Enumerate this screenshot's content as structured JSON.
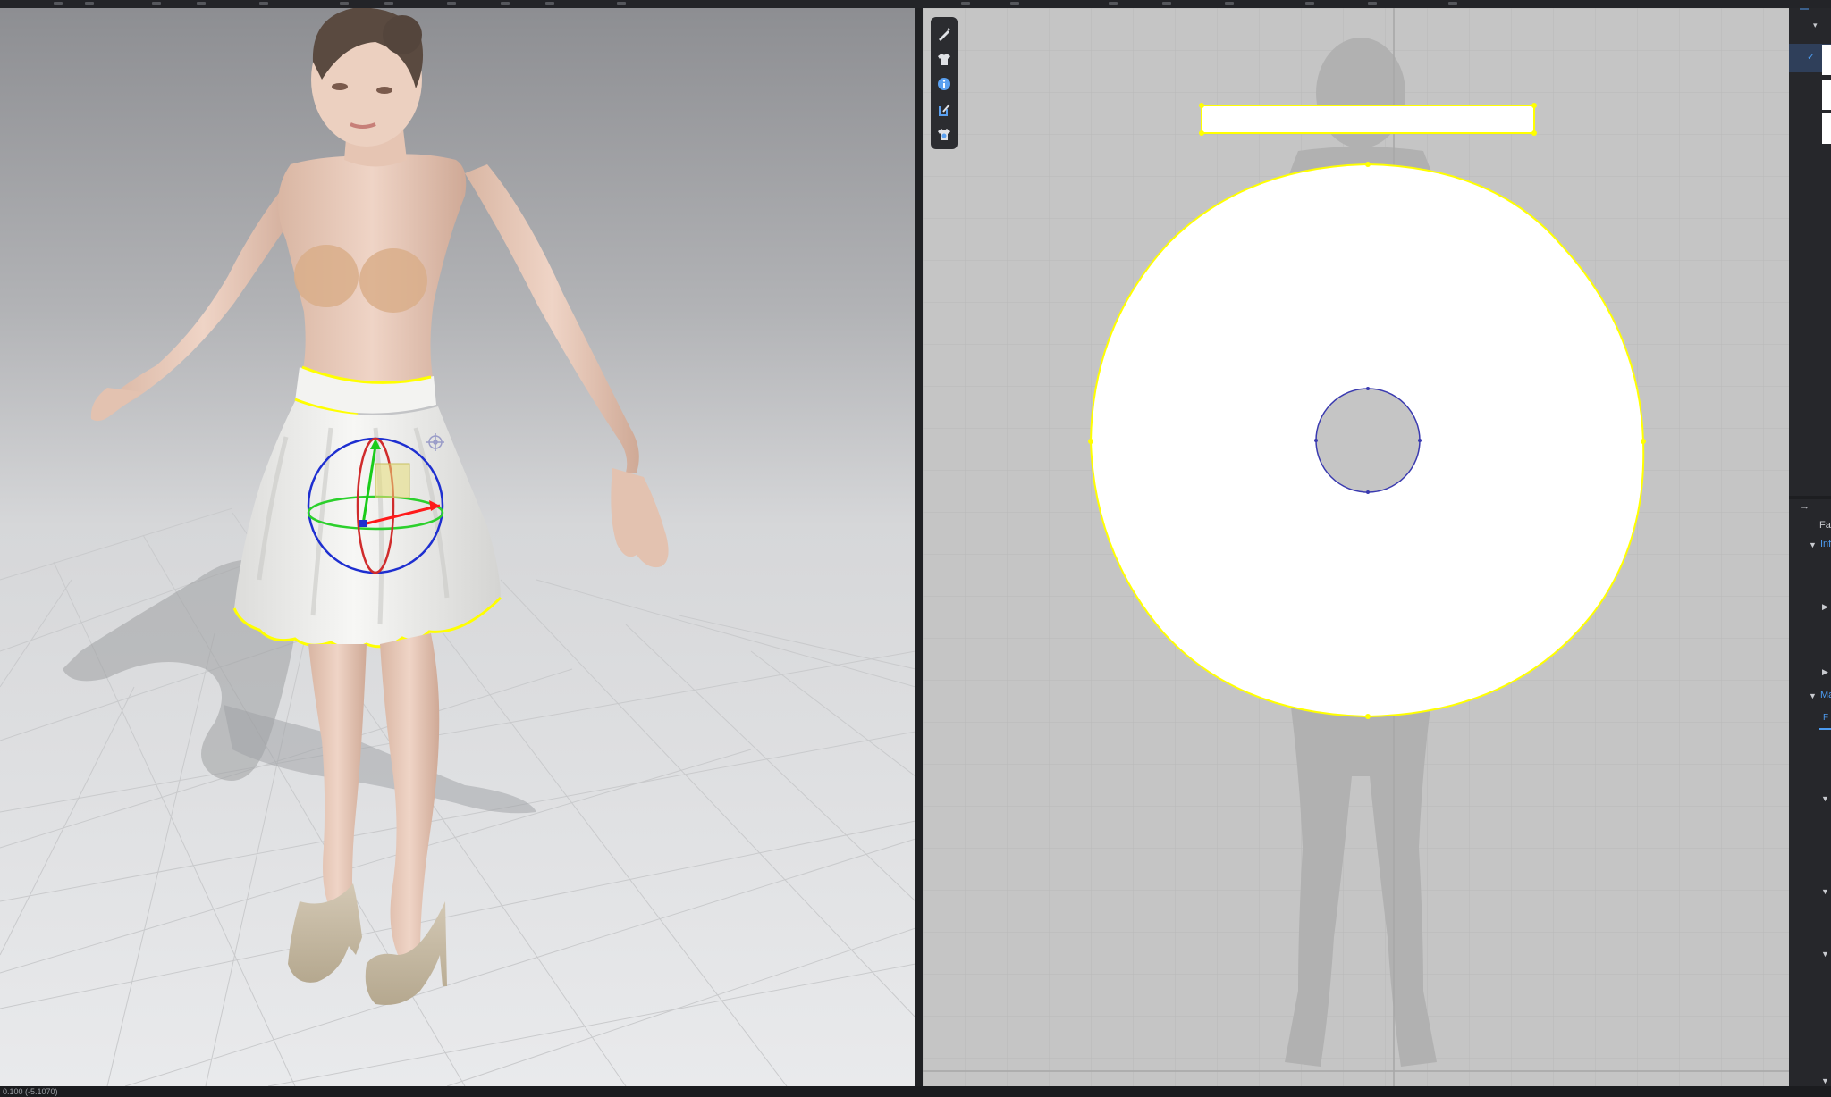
{
  "status": {
    "coords": "0.100 (-5.1070)"
  },
  "window": {
    "accent": "#4c9bf0",
    "highlight": "#ffff00"
  },
  "viewport2d": {
    "toolbar": {
      "tools": [
        {
          "icon": "pen-icon"
        },
        {
          "icon": "shirt-icon"
        },
        {
          "icon": "info-icon"
        },
        {
          "icon": "tshirt-pen-icon"
        },
        {
          "icon": "shirt-settings-icon"
        }
      ]
    }
  },
  "right_panel": {
    "check": "✓",
    "arrow": "→",
    "fabric_label": "Fal",
    "info_section": "Info",
    "material_section": "Ma",
    "front_tab": "F"
  }
}
